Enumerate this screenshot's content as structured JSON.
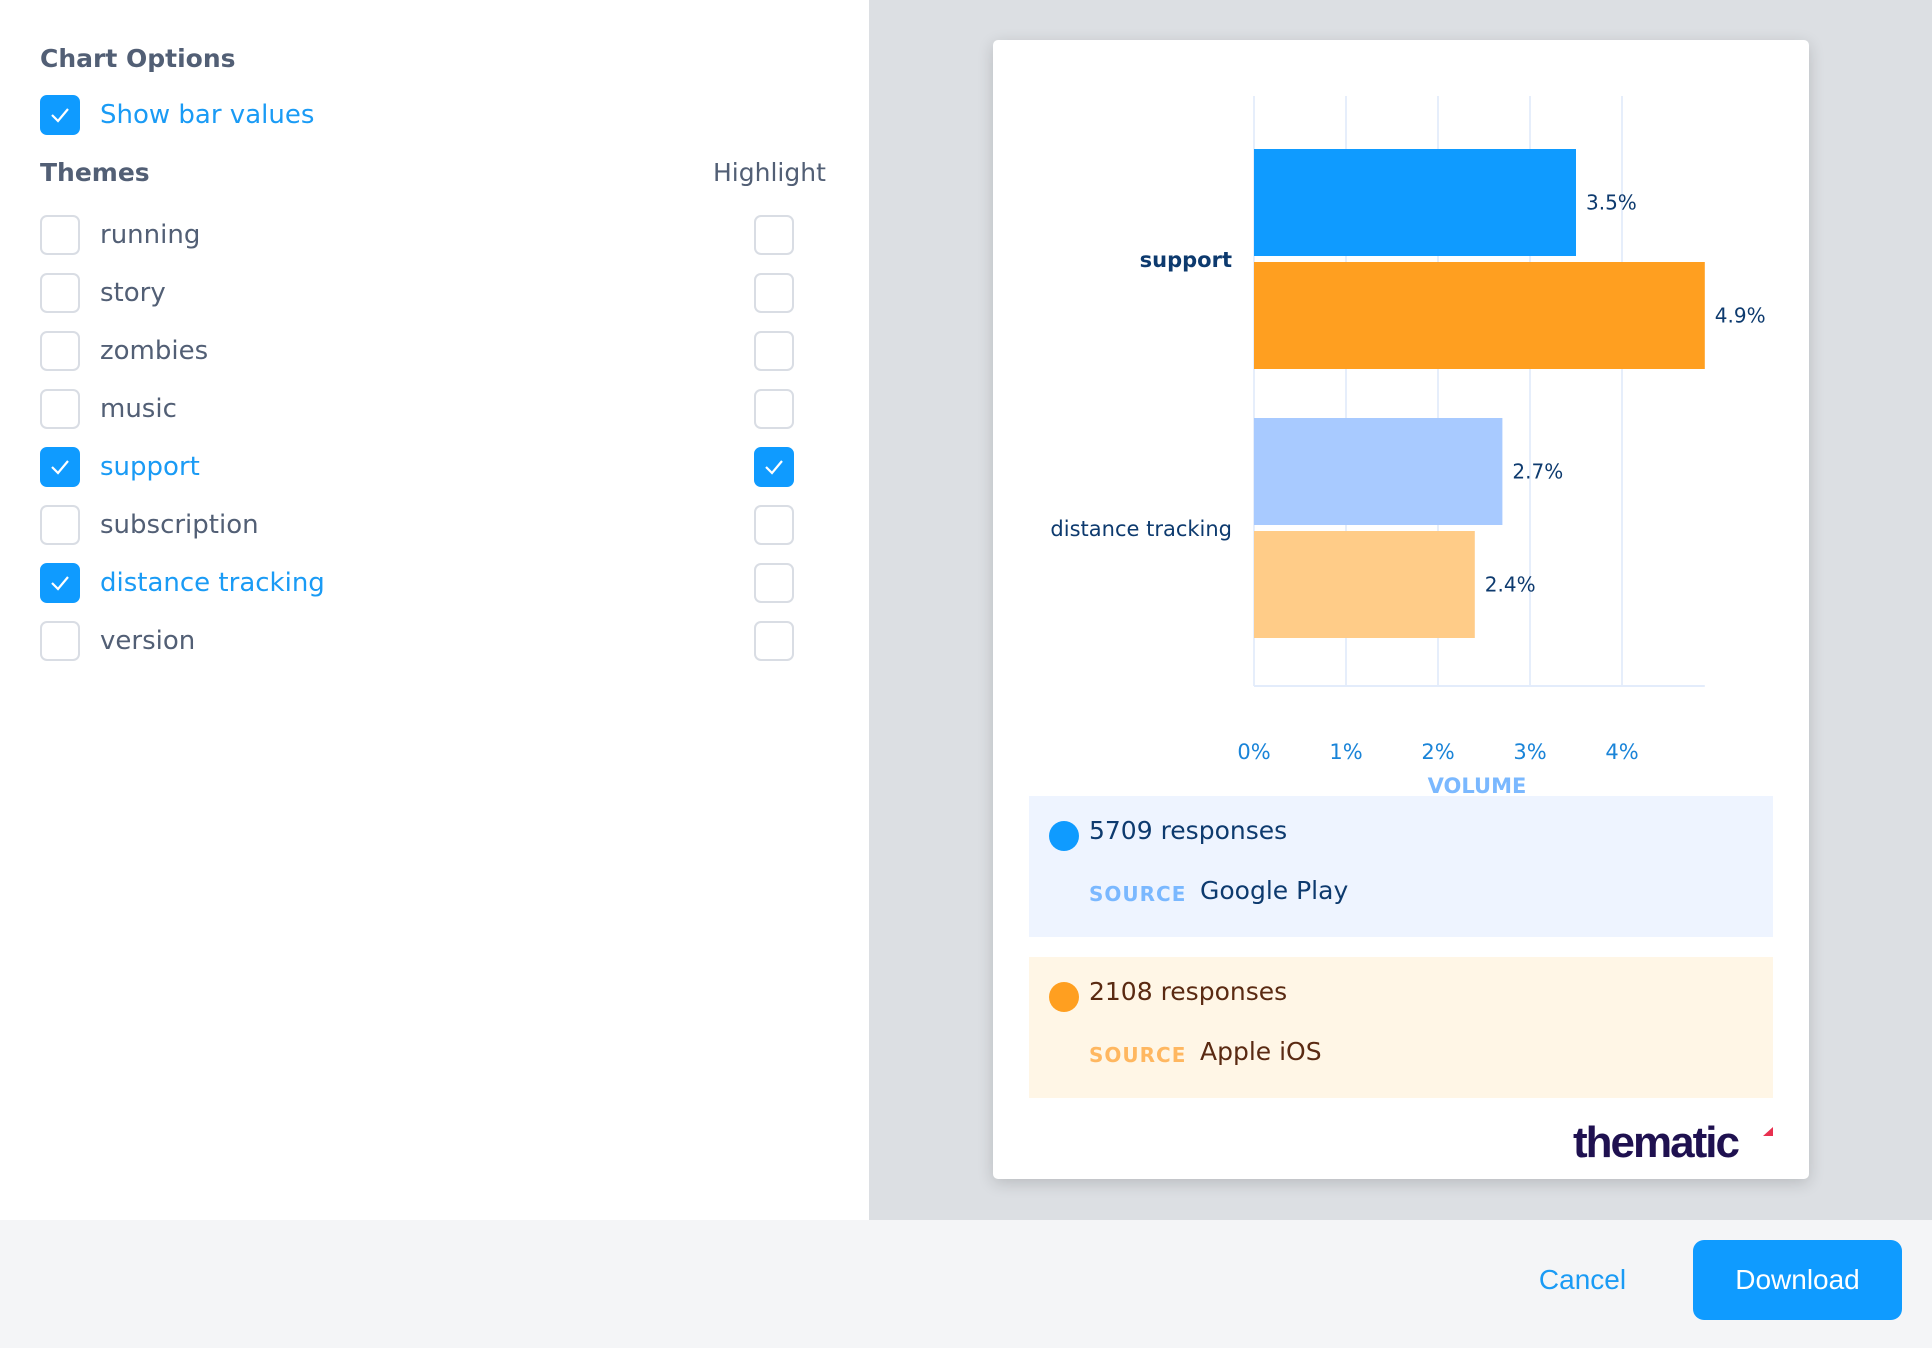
{
  "options": {
    "title": "Chart Options",
    "show_bar_values": {
      "label": "Show bar values",
      "checked": true
    }
  },
  "themes": {
    "title": "Themes",
    "highlight_header": "Highlight",
    "items": [
      {
        "label": "running",
        "checked": false,
        "highlight": false
      },
      {
        "label": "story",
        "checked": false,
        "highlight": false
      },
      {
        "label": "zombies",
        "checked": false,
        "highlight": false
      },
      {
        "label": "music",
        "checked": false,
        "highlight": false
      },
      {
        "label": "support",
        "checked": true,
        "highlight": true
      },
      {
        "label": "subscription",
        "checked": false,
        "highlight": false
      },
      {
        "label": "distance tracking",
        "checked": true,
        "highlight": false
      },
      {
        "label": "version",
        "checked": false,
        "highlight": false
      }
    ]
  },
  "colors": {
    "accent": "#0f9bff",
    "series_primary": "#0f9bff",
    "series_primary_light": "#a8caff",
    "series_secondary": "#ff9f20",
    "series_secondary_light": "#ffcc88",
    "logo": "#1f1150",
    "logo_accent": "#e8304f"
  },
  "chart_data": {
    "type": "bar",
    "orientation": "horizontal",
    "categories": [
      "support",
      "distance tracking"
    ],
    "highlighted_categories": [
      "support"
    ],
    "series": [
      {
        "name": "Google Play",
        "values": [
          3.5,
          2.7
        ]
      },
      {
        "name": "Apple iOS",
        "values": [
          4.9,
          2.4
        ]
      }
    ],
    "value_labels": [
      [
        "3.5%",
        "2.7%"
      ],
      [
        "4.9%",
        "2.4%"
      ]
    ],
    "xlabel": "VOLUME",
    "ylabel": "",
    "xticks": [
      "0%",
      "1%",
      "2%",
      "3%",
      "4%"
    ],
    "xlim": [
      0,
      4.9
    ],
    "grid": true,
    "unit": "%"
  },
  "legend": [
    {
      "count_text": "5709 responses",
      "source_key": "SOURCE",
      "source": "Google Play",
      "dot_color": "#0f9bff",
      "bg": "#eef4ff",
      "text_color": "#0d3a6e",
      "key_color": "#7ab8ff"
    },
    {
      "count_text": "2108 responses",
      "source_key": "SOURCE",
      "source": "Apple iOS",
      "dot_color": "#ff9f20",
      "bg": "#fff6e6",
      "text_color": "#5a2a12",
      "key_color": "#ffb760"
    }
  ],
  "logo": {
    "text": "thematic"
  },
  "footer": {
    "cancel_label": "Cancel",
    "download_label": "Download"
  }
}
